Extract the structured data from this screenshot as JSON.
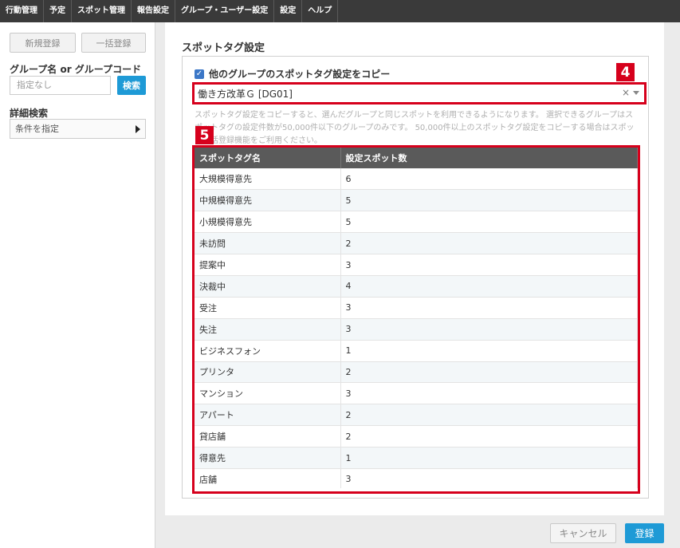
{
  "nav": [
    "行動管理",
    "予定",
    "スポット管理",
    "報告設定",
    "グループ・ユーザー設定",
    "設定",
    "ヘルプ"
  ],
  "sidebar": {
    "new_button": "新規登録",
    "bulk_button": "一括登録",
    "group_label": "グループ名 or グループコード",
    "group_placeholder": "指定なし",
    "search_button": "検索",
    "detail_label": "詳細検索",
    "condition_label": "条件を指定"
  },
  "main": {
    "title": "スポットタグ設定",
    "copy_checkbox_label": "他のグループのスポットタグ設定をコピー",
    "selected_group": "働き方改革Ｇ [DG01]",
    "clear_symbol": "×",
    "help_text": "スポットタグ設定をコピーすると、選んだグループと同じスポットを利用できるようになります。 選択できるグループはスポットタグの設定件数が50,000件以下のグループのみです。 50,000件以上のスポットタグ設定をコピーする場合はスポット一括登録機能をご利用ください。",
    "badge_select": "4",
    "badge_table": "5",
    "table": {
      "headers": [
        "スポットタグ名",
        "設定スポット数"
      ],
      "rows": [
        [
          "大規模得意先",
          "6"
        ],
        [
          "中規模得意先",
          "5"
        ],
        [
          "小規模得意先",
          "5"
        ],
        [
          "未訪問",
          "2"
        ],
        [
          "提案中",
          "3"
        ],
        [
          "決裁中",
          "4"
        ],
        [
          "受注",
          "3"
        ],
        [
          "失注",
          "3"
        ],
        [
          "ビジネスフォン",
          "1"
        ],
        [
          "プリンタ",
          "2"
        ],
        [
          "マンション",
          "3"
        ],
        [
          "アパート",
          "2"
        ],
        [
          "貸店舗",
          "2"
        ],
        [
          "得意先",
          "1"
        ],
        [
          "店舗",
          "3"
        ]
      ]
    }
  },
  "footer": {
    "cancel_button": "キャンセル",
    "save_button": "登録"
  },
  "colors": {
    "accent": "#1e9ad6",
    "highlight": "#d6001c",
    "nav_bg": "#3a3a3a",
    "table_header": "#5a5a5a"
  }
}
